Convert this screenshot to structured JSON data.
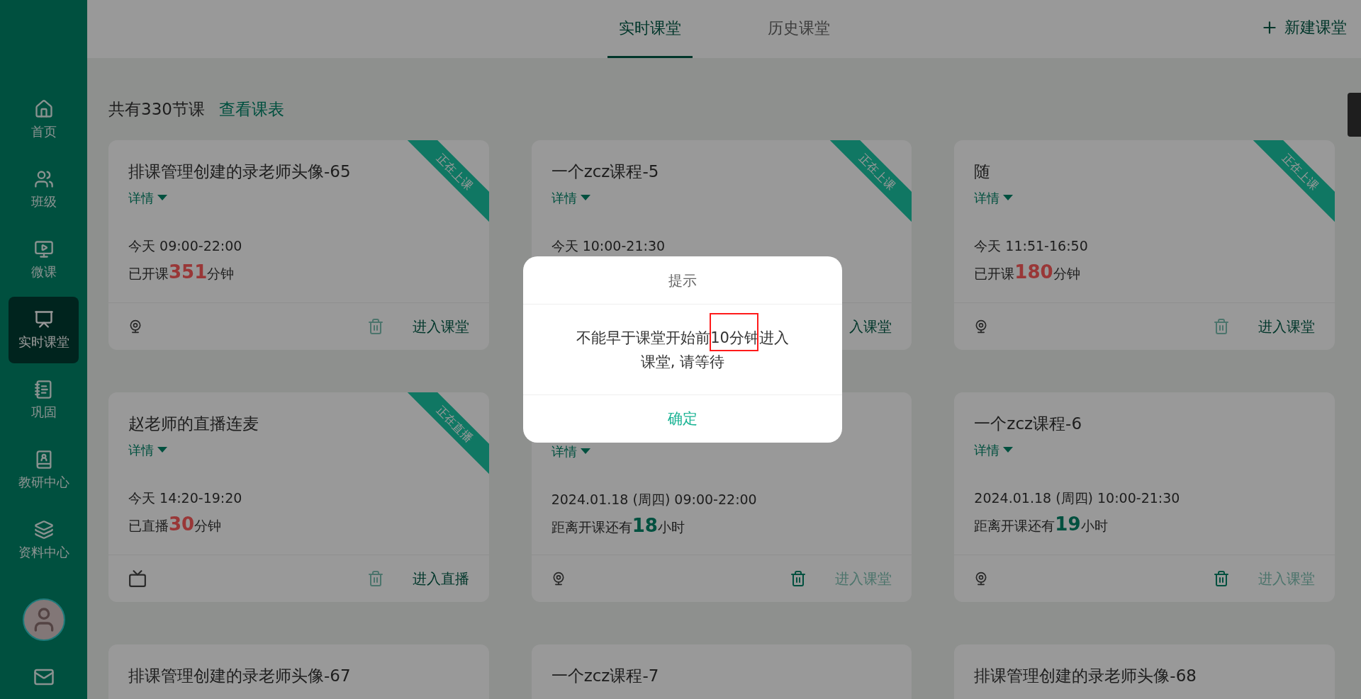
{
  "sidebar": {
    "items": [
      {
        "label": "首页",
        "selected": false
      },
      {
        "label": "班级",
        "selected": false
      },
      {
        "label": "微课",
        "selected": false
      },
      {
        "label": "实时课堂",
        "selected": true
      },
      {
        "label": "巩固",
        "selected": false
      },
      {
        "label": "教研中心",
        "selected": false
      },
      {
        "label": "资料中心",
        "selected": false
      }
    ]
  },
  "tabs": [
    {
      "label": "实时课堂",
      "selected": true
    },
    {
      "label": "历史课堂",
      "selected": false
    }
  ],
  "new_button": {
    "label": "新建课堂"
  },
  "summary": {
    "count": "共有330节课",
    "link": "查看课表"
  },
  "cards": [
    {
      "title": "排课管理创建的录老师头像-65",
      "details": "详情",
      "ribbon": "正在上课",
      "time": "今天 09:00-22:00",
      "progress": {
        "kind": "elapsed",
        "prefix": "已开课",
        "number": "351",
        "suffix": "分钟"
      },
      "kind": "classroom",
      "delete_disabled": true,
      "enter": {
        "label": "进入课堂",
        "disabled": false
      }
    },
    {
      "title": "一个zcz课程-5",
      "details": "详情",
      "ribbon": "正在上课",
      "time": "今天 10:00-21:30",
      "enter": {
        "label": "入课堂",
        "disabled": false
      }
    },
    {
      "title": "随",
      "details": "详情",
      "ribbon": "正在上课",
      "time": "今天 11:51-16:50",
      "progress": {
        "kind": "elapsed",
        "prefix": "已开课",
        "number": "180",
        "suffix": "分钟"
      },
      "kind": "classroom",
      "delete_disabled": true,
      "enter": {
        "label": "进入课堂",
        "disabled": false
      }
    },
    {
      "title": "赵老师的直播连麦",
      "details": "详情",
      "ribbon": "正在直播",
      "time": "今天 14:20-19:20",
      "progress": {
        "kind": "elapsed",
        "prefix": "已直播",
        "number": "30",
        "suffix": "分钟"
      },
      "kind": "live",
      "delete_disabled": true,
      "enter": {
        "label": "进入直播",
        "disabled": false
      }
    },
    {
      "details": "详情",
      "time": "2024.01.18 (周四) 09:00-22:00",
      "progress": {
        "kind": "countdown",
        "prefix": "距离开课还有",
        "number": "18",
        "suffix": "小时"
      },
      "kind": "classroom",
      "delete_disabled": false,
      "enter": {
        "label": "进入课堂",
        "disabled": true
      }
    },
    {
      "title": "一个zcz课程-6",
      "details": "详情",
      "time": "2024.01.18 (周四) 10:00-21:30",
      "progress": {
        "kind": "countdown",
        "prefix": "距离开课还有",
        "number": "19",
        "suffix": "小时"
      },
      "kind": "classroom",
      "delete_disabled": false,
      "enter": {
        "label": "进入课堂",
        "disabled": true
      }
    },
    {
      "title": "排课管理创建的录老师头像-67"
    },
    {
      "title": "一个zcz课程-7"
    },
    {
      "title": "排课管理创建的录老师头像-68"
    }
  ],
  "dialog": {
    "title": "提示",
    "message": "不能早于课堂开始前10分钟进入课堂, 请等待",
    "confirm": "确定"
  }
}
